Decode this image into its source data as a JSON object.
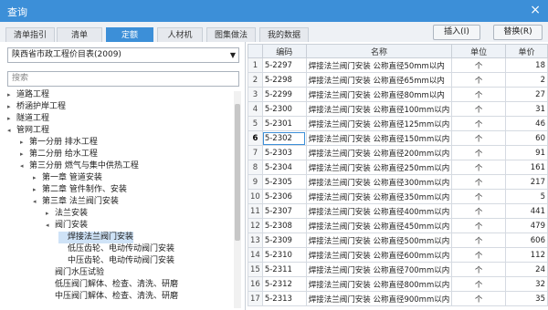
{
  "window": {
    "title": "查询",
    "close_label": "×"
  },
  "tabs": [
    {
      "label": "清单指引",
      "active": false
    },
    {
      "label": "清单",
      "active": false
    },
    {
      "label": "定额",
      "active": true
    },
    {
      "label": "人材机",
      "active": false
    },
    {
      "label": "图集做法",
      "active": false
    },
    {
      "label": "我的数据",
      "active": false
    }
  ],
  "buttons": {
    "insert": "插入(I)",
    "replace": "替换(R)"
  },
  "left": {
    "library_value": "陕西省市政工程价目表(2009)",
    "search_placeholder": "搜索",
    "tree": [
      {
        "label": "道路工程",
        "toggle": "▸",
        "level": 0
      },
      {
        "label": "桥涵护岸工程",
        "toggle": "▸",
        "level": 0
      },
      {
        "label": "隧道工程",
        "toggle": "▸",
        "level": 0
      },
      {
        "label": "管网工程",
        "toggle": "◂",
        "level": 0
      },
      {
        "label": "第一分册 排水工程",
        "toggle": "▸",
        "level": 1
      },
      {
        "label": "第二分册 给水工程",
        "toggle": "▸",
        "level": 1
      },
      {
        "label": "第三分册 燃气与集中供热工程",
        "toggle": "◂",
        "level": 1
      },
      {
        "label": "第一章 管道安装",
        "toggle": "▸",
        "level": 2
      },
      {
        "label": "第二章 管件制作、安装",
        "toggle": "▸",
        "level": 2
      },
      {
        "label": "第三章 法兰阀门安装",
        "toggle": "◂",
        "level": 2
      },
      {
        "label": "法兰安装",
        "toggle": "▸",
        "level": 3
      },
      {
        "label": "阀门安装",
        "toggle": "◂",
        "level": 3
      },
      {
        "label": "焊接法兰阀门安装",
        "toggle": "",
        "level": 4,
        "selected": true
      },
      {
        "label": "低压齿轮、电动传动阀门安装",
        "toggle": "",
        "level": 4
      },
      {
        "label": "中压齿轮、电动传动阀门安装",
        "toggle": "",
        "level": 4
      },
      {
        "label": "阀门水压试验",
        "toggle": "",
        "level": 3
      },
      {
        "label": "低压阀门解体、检查、清洗、研磨",
        "toggle": "",
        "level": 3
      },
      {
        "label": "中压阀门解体、检查、清洗、研磨",
        "toggle": "",
        "level": 3
      }
    ]
  },
  "grid": {
    "headers": {
      "code": "编码",
      "name": "名称",
      "unit": "单位",
      "price": "单价"
    },
    "rows": [
      {
        "n": "1",
        "code": "5-2297",
        "name": "焊接法兰阀门安装 公称直径50mm以内",
        "unit": "个",
        "price": "18"
      },
      {
        "n": "2",
        "code": "5-2298",
        "name": "焊接法兰阀门安装 公称直径65mm以内",
        "unit": "个",
        "price": "2"
      },
      {
        "n": "3",
        "code": "5-2299",
        "name": "焊接法兰阀门安装 公称直径80mm以内",
        "unit": "个",
        "price": "27"
      },
      {
        "n": "4",
        "code": "5-2300",
        "name": "焊接法兰阀门安装 公称直径100mm以内",
        "unit": "个",
        "price": "31"
      },
      {
        "n": "5",
        "code": "5-2301",
        "name": "焊接法兰阀门安装 公称直径125mm以内",
        "unit": "个",
        "price": "46"
      },
      {
        "n": "6",
        "code": "5-2302",
        "name": "焊接法兰阀门安装 公称直径150mm以内",
        "unit": "个",
        "price": "60",
        "current": true
      },
      {
        "n": "7",
        "code": "5-2303",
        "name": "焊接法兰阀门安装 公称直径200mm以内",
        "unit": "个",
        "price": "91"
      },
      {
        "n": "8",
        "code": "5-2304",
        "name": "焊接法兰阀门安装 公称直径250mm以内",
        "unit": "个",
        "price": "161"
      },
      {
        "n": "9",
        "code": "5-2305",
        "name": "焊接法兰阀门安装 公称直径300mm以内",
        "unit": "个",
        "price": "217"
      },
      {
        "n": "10",
        "code": "5-2306",
        "name": "焊接法兰阀门安装 公称直径350mm以内",
        "unit": "个",
        "price": "5"
      },
      {
        "n": "11",
        "code": "5-2307",
        "name": "焊接法兰阀门安装 公称直径400mm以内",
        "unit": "个",
        "price": "441"
      },
      {
        "n": "12",
        "code": "5-2308",
        "name": "焊接法兰阀门安装 公称直径450mm以内",
        "unit": "个",
        "price": "479"
      },
      {
        "n": "13",
        "code": "5-2309",
        "name": "焊接法兰阀门安装 公称直径500mm以内",
        "unit": "个",
        "price": "606"
      },
      {
        "n": "14",
        "code": "5-2310",
        "name": "焊接法兰阀门安装 公称直径600mm以内",
        "unit": "个",
        "price": "112"
      },
      {
        "n": "15",
        "code": "5-2311",
        "name": "焊接法兰阀门安装 公称直径700mm以内",
        "unit": "个",
        "price": "24"
      },
      {
        "n": "16",
        "code": "5-2312",
        "name": "焊接法兰阀门安装 公称直径800mm以内",
        "unit": "个",
        "price": "32"
      },
      {
        "n": "17",
        "code": "5-2313",
        "name": "焊接法兰阀门安装 公称直径900mm以内",
        "unit": "个",
        "price": "35"
      }
    ]
  }
}
